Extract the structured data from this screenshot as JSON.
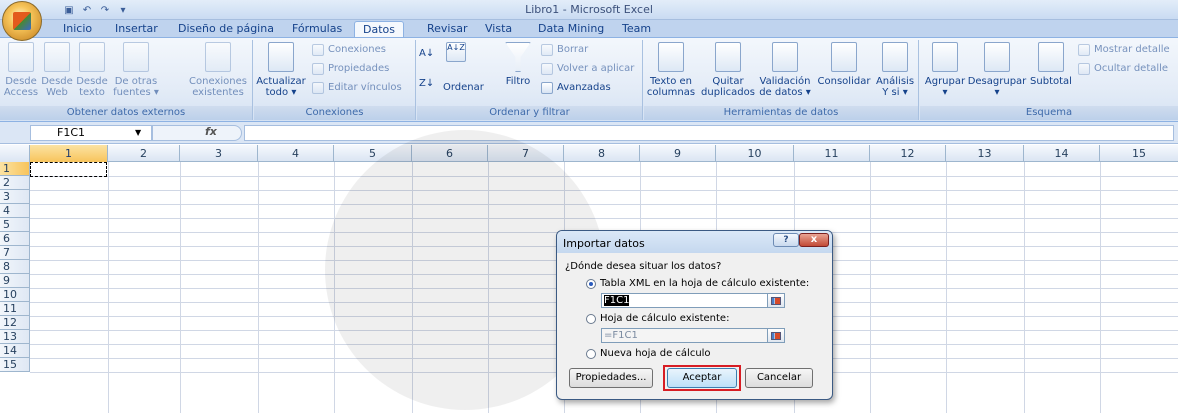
{
  "window": {
    "title": "Libro1 - Microsoft Excel"
  },
  "tabs": [
    "Inicio",
    "Insertar",
    "Diseño de página",
    "Fórmulas",
    "Datos",
    "Revisar",
    "Vista",
    "Data Mining",
    "Team"
  ],
  "active_tab": "Datos",
  "ribbon": {
    "obtener": {
      "label": "Obtener datos externos",
      "buttons": [
        {
          "line1": "Desde",
          "line2": "Access"
        },
        {
          "line1": "Desde",
          "line2": "Web"
        },
        {
          "line1": "Desde",
          "line2": "texto"
        },
        {
          "line1": "De otras",
          "line2": "fuentes ▾"
        },
        {
          "line1": "Conexiones",
          "line2": "existentes"
        }
      ]
    },
    "conexiones": {
      "label": "Conexiones",
      "refresh": {
        "line1": "Actualizar",
        "line2": "todo ▾"
      },
      "small": [
        "Conexiones",
        "Propiedades",
        "Editar vínculos"
      ]
    },
    "ordenar": {
      "label": "Ordenar y filtrar",
      "sort_az": "A↓Z",
      "ordenar": "Ordenar",
      "filtro": "Filtro",
      "small": [
        "Borrar",
        "Volver a aplicar",
        "Avanzadas"
      ]
    },
    "herramientas": {
      "label": "Herramientas de datos",
      "buttons": [
        {
          "line1": "Texto en",
          "line2": "columnas"
        },
        {
          "line1": "Quitar",
          "line2": "duplicados"
        },
        {
          "line1": "Validación",
          "line2": "de datos ▾"
        },
        {
          "line1": "Consolidar",
          "line2": ""
        },
        {
          "line1": "Análisis",
          "line2": "Y si ▾"
        }
      ]
    },
    "esquema": {
      "label": "Esquema",
      "buttons": [
        {
          "line1": "Agrupar",
          "line2": "▾"
        },
        {
          "line1": "Desagrupar",
          "line2": "▾"
        },
        {
          "line1": "Subtotal",
          "line2": ""
        }
      ],
      "small": [
        "Mostrar detalle",
        "Ocultar detalle"
      ]
    }
  },
  "formula_bar": {
    "name_box": "F1C1",
    "fx": "fx",
    "formula": ""
  },
  "columns": [
    "1",
    "2",
    "3",
    "4",
    "5",
    "6",
    "7",
    "8",
    "9",
    "10",
    "11",
    "12",
    "13",
    "14",
    "15"
  ],
  "rows": [
    "1",
    "2",
    "3",
    "4",
    "5",
    "6",
    "7",
    "8",
    "9",
    "10",
    "11",
    "12",
    "13",
    "14",
    "15"
  ],
  "dialog": {
    "title": "Importar datos",
    "help": "?",
    "close": "x",
    "question": "¿Dónde desea situar los datos?",
    "option_xml": "Tabla XML en la hoja de cálculo existente:",
    "xml_ref": "F1C1",
    "option_existing": "Hoja de cálculo existente:",
    "existing_ref": "=F1C1",
    "option_new": "Nueva hoja de cálculo",
    "btn_props": "Propiedades...",
    "btn_accept": "Aceptar",
    "btn_cancel": "Cancelar"
  },
  "colors": {
    "ribbon_text": "#15428b",
    "highlight": "#d71d24",
    "selected_header": "#f8c45c"
  }
}
